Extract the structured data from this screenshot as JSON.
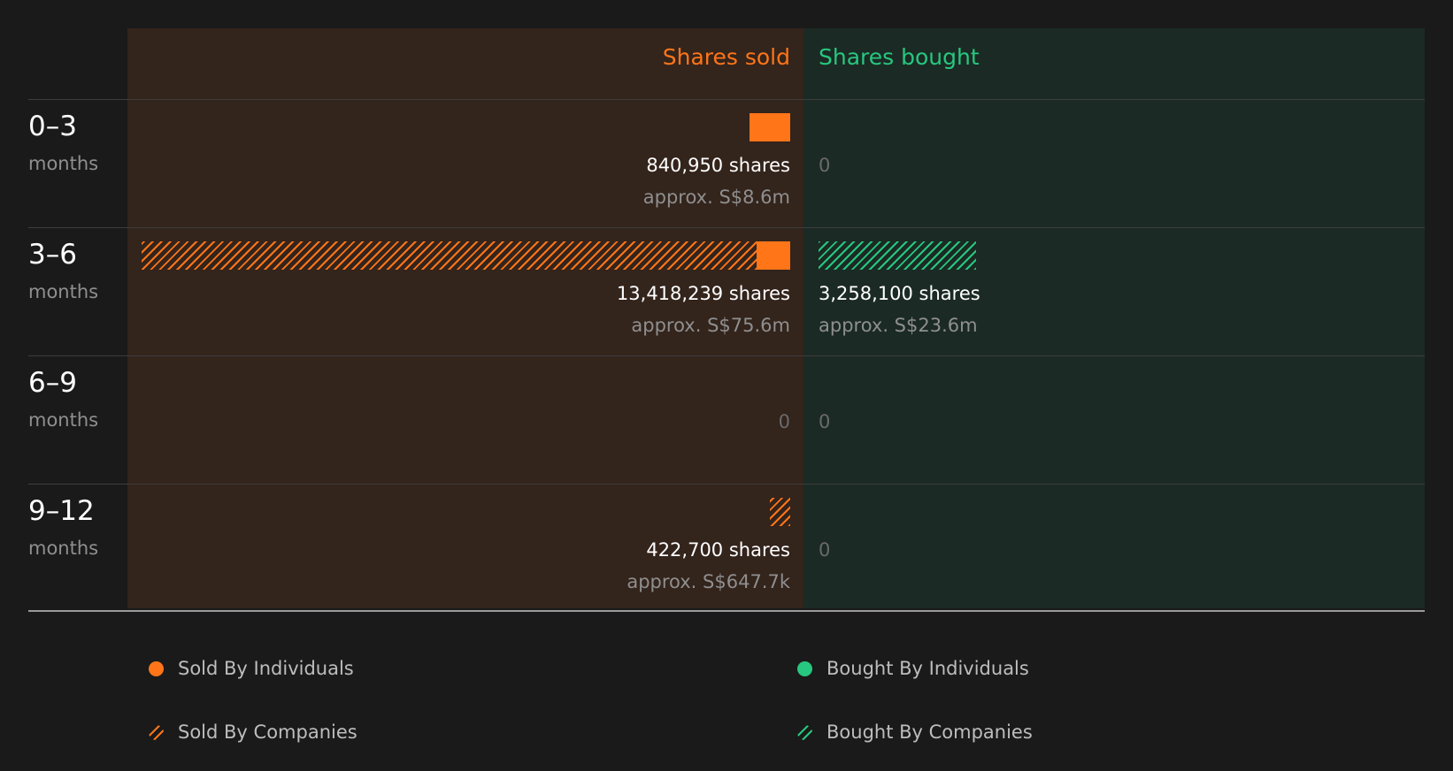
{
  "colors": {
    "background": "#1a1a1a",
    "sold": "#ff7518",
    "bought": "#27c77f",
    "sold_panel": "#33241c",
    "bought_panel": "#1b2a24"
  },
  "chart_data": {
    "type": "bar",
    "orientation": "horizontal-diverging",
    "columns": {
      "sold": "Shares sold",
      "bought": "Shares bought"
    },
    "categories": [
      {
        "range": "0–3",
        "unit": "months"
      },
      {
        "range": "3–6",
        "unit": "months"
      },
      {
        "range": "6–9",
        "unit": "months"
      },
      {
        "range": "9–12",
        "unit": "months"
      }
    ],
    "series": [
      {
        "name": "Sold By Individuals",
        "side": "sold",
        "pattern": "solid",
        "values": [
          840950,
          700000,
          0,
          0
        ]
      },
      {
        "name": "Sold By Companies",
        "side": "sold",
        "pattern": "hatched",
        "values": [
          0,
          12718239,
          0,
          422700
        ]
      },
      {
        "name": "Bought By Individuals",
        "side": "bought",
        "pattern": "solid",
        "values": [
          0,
          0,
          0,
          0
        ]
      },
      {
        "name": "Bought By Companies",
        "side": "bought",
        "pattern": "hatched",
        "values": [
          0,
          3258100,
          0,
          0
        ]
      }
    ],
    "sold_totals": [
      {
        "shares": "840,950 shares",
        "approx": "approx. S$8.6m"
      },
      {
        "shares": "13,418,239 shares",
        "approx": "approx. S$75.6m"
      },
      {
        "zero": "0"
      },
      {
        "shares": "422,700 shares",
        "approx": "approx. S$647.7k"
      }
    ],
    "bought_totals": [
      {
        "zero": "0"
      },
      {
        "shares": "3,258,100 shares",
        "approx": "approx. S$23.6m"
      },
      {
        "zero": "0"
      },
      {
        "zero": "0"
      }
    ],
    "legend": [
      {
        "label": "Sold By Individuals",
        "side": "sold",
        "pattern": "solid"
      },
      {
        "label": "Bought By Individuals",
        "side": "bought",
        "pattern": "solid"
      },
      {
        "label": "Sold By Companies",
        "side": "sold",
        "pattern": "hatched"
      },
      {
        "label": "Bought By Companies",
        "side": "bought",
        "pattern": "hatched"
      }
    ],
    "xlim": [
      0,
      13418239
    ],
    "legend_placement": "bottom"
  }
}
